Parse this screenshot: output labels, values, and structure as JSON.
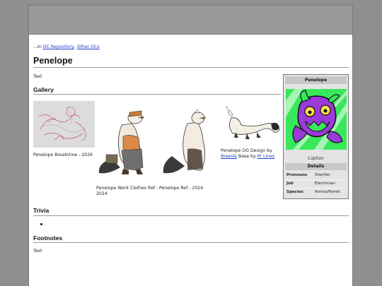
{
  "breadcrumb": {
    "prefix": "...In ",
    "links": [
      "OC Repository",
      "Other OCs"
    ],
    "separator": ", "
  },
  "page_title": "Penelope",
  "intro_text": "Text",
  "sections": {
    "gallery": "Gallery",
    "trivia": "Trivia",
    "footnotes": "Footnotes",
    "footnotes_text": "Text"
  },
  "gallery": [
    {
      "caption": "Penelope Breaktime - 2026"
    },
    {
      "caption": "Penelope Work Clothes Ref - 2024"
    },
    {
      "caption": "Penelope Ref - 2024"
    },
    {
      "caption_prefix": "Penelope OG Design by ",
      "link1": "Breesle",
      "caption_mid": " Base by ",
      "link2": "M_Lines"
    }
  ],
  "infobox": {
    "title": "Penelope",
    "caption": "Caption",
    "details_header": "Details",
    "rows": [
      {
        "key": "Pronouns",
        "value": "She/Her"
      },
      {
        "key": "Job",
        "value": "Electrician"
      },
      {
        "key": "Species",
        "value": "Anima/Ferret"
      }
    ]
  },
  "colors": {
    "link": "#1a3ec9",
    "infobox_bg": "#e4e4e4",
    "accent_green": "#39e85a",
    "accent_purple": "#9a3ad8"
  }
}
